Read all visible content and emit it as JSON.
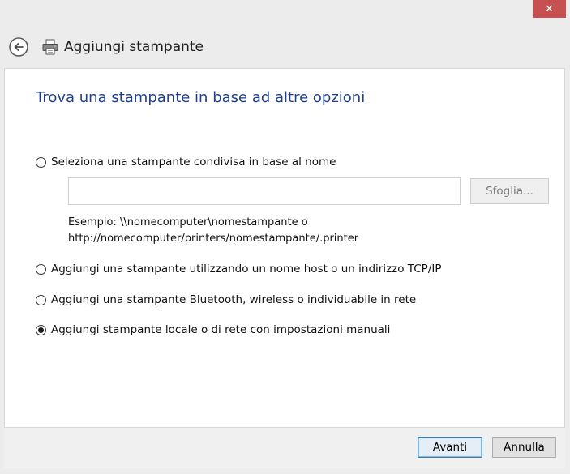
{
  "window": {
    "title": "Aggiungi stampante",
    "close_glyph": "✕"
  },
  "page": {
    "heading": "Trova una stampante in base ad altre opzioni"
  },
  "options": [
    {
      "label": "Seleziona una stampante condivisa in base al nome",
      "selected": false
    },
    {
      "label": "Aggiungi una stampante utilizzando un nome host o un indirizzo TCP/IP",
      "selected": false
    },
    {
      "label": "Aggiungi una stampante Bluetooth, wireless o individuabile in rete",
      "selected": false
    },
    {
      "label": "Aggiungi stampante locale o di rete con impostazioni manuali",
      "selected": true
    }
  ],
  "shared_name": {
    "value": "",
    "placeholder": "",
    "browse_label": "Sfoglia...",
    "example_line1": "Esempio: \\\\nomecomputer\\nomestampante o",
    "example_line2": "http://nomecomputer/printers/nomestampante/.printer"
  },
  "footer": {
    "next_label": "Avanti",
    "cancel_label": "Annulla"
  },
  "colors": {
    "heading": "#1e3f8a",
    "close_button": "#c75050",
    "default_button_border": "#3c7fb1"
  },
  "icons": {
    "back": "back-arrow-icon",
    "printer": "printer-icon",
    "close": "close-icon"
  }
}
